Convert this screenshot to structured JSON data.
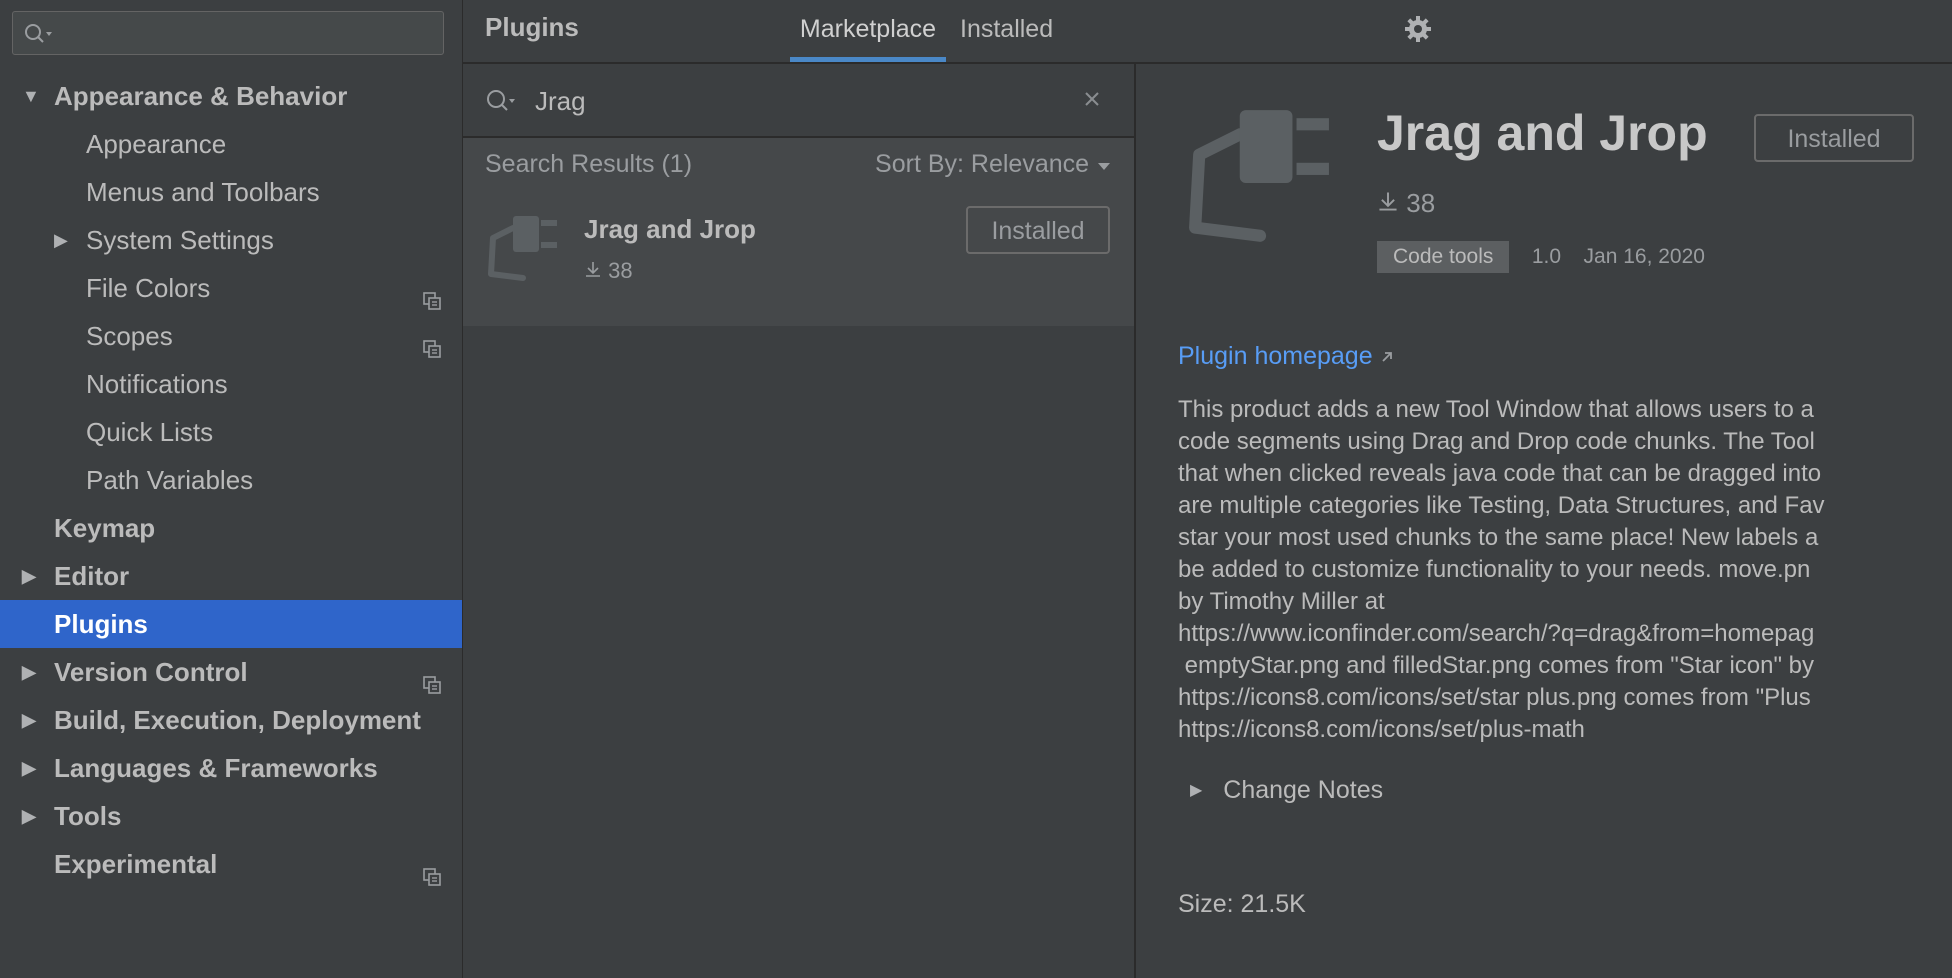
{
  "sidebar": {
    "search": {
      "placeholder": ""
    },
    "items": [
      {
        "label": "Appearance & Behavior",
        "level": 0,
        "arrow": "expanded",
        "has_copy_icon": false,
        "selected": false
      },
      {
        "label": "Appearance",
        "level": 1,
        "arrow": "none",
        "has_copy_icon": false,
        "selected": false
      },
      {
        "label": "Menus and Toolbars",
        "level": 1,
        "arrow": "none",
        "has_copy_icon": false,
        "selected": false
      },
      {
        "label": "System Settings",
        "level": 1,
        "arrow": "collapsed",
        "has_copy_icon": false,
        "selected": false
      },
      {
        "label": "File Colors",
        "level": 1,
        "arrow": "none",
        "has_copy_icon": true,
        "selected": false
      },
      {
        "label": "Scopes",
        "level": 1,
        "arrow": "none",
        "has_copy_icon": true,
        "selected": false
      },
      {
        "label": "Notifications",
        "level": 1,
        "arrow": "none",
        "has_copy_icon": false,
        "selected": false
      },
      {
        "label": "Quick Lists",
        "level": 1,
        "arrow": "none",
        "has_copy_icon": false,
        "selected": false
      },
      {
        "label": "Path Variables",
        "level": 1,
        "arrow": "none",
        "has_copy_icon": false,
        "selected": false
      },
      {
        "label": "Keymap",
        "level": 0,
        "arrow": "none",
        "has_copy_icon": false,
        "selected": false
      },
      {
        "label": "Editor",
        "level": 0,
        "arrow": "collapsed",
        "has_copy_icon": false,
        "selected": false
      },
      {
        "label": "Plugins",
        "level": 0,
        "arrow": "none",
        "has_copy_icon": false,
        "selected": true
      },
      {
        "label": "Version Control",
        "level": 0,
        "arrow": "collapsed",
        "has_copy_icon": true,
        "selected": false
      },
      {
        "label": "Build, Execution, Deployment",
        "level": 0,
        "arrow": "collapsed",
        "has_copy_icon": false,
        "selected": false
      },
      {
        "label": "Languages & Frameworks",
        "level": 0,
        "arrow": "collapsed",
        "has_copy_icon": false,
        "selected": false
      },
      {
        "label": "Tools",
        "level": 0,
        "arrow": "collapsed",
        "has_copy_icon": false,
        "selected": false
      },
      {
        "label": "Experimental",
        "level": 0,
        "arrow": "none",
        "has_copy_icon": true,
        "selected": false
      }
    ]
  },
  "header": {
    "title": "Plugins",
    "tabs": [
      {
        "label": "Marketplace",
        "active": true
      },
      {
        "label": "Installed",
        "active": false
      }
    ],
    "settings_icon": "gear-icon"
  },
  "plugin_list": {
    "search_value": "Jrag",
    "results_label": "Search Results (1)",
    "sort_label": "Sort By: Relevance",
    "results": [
      {
        "name": "Jrag and Jrop",
        "downloads": "38",
        "button": "Installed"
      }
    ]
  },
  "detail": {
    "name": "Jrag and Jrop",
    "button": "Installed",
    "downloads": "38",
    "category": "Code tools",
    "version": "1.0",
    "date": "Jan 16, 2020",
    "homepage_label": "Plugin homepage",
    "description_lines": [
      "This product adds a new Tool Window that allows users to a",
      "code segments using Drag and Drop code chunks. The Tool",
      "that when clicked reveals java code that can be dragged into",
      "are multiple categories like Testing, Data Structures, and Fav",
      "star your most used chunks to the same place! New labels a",
      "be added to customize functionality to your needs. move.pn",
      "by Timothy Miller at",
      "https://www.iconfinder.com/search/?q=drag&from=homepag",
      " emptyStar.png and filledStar.png comes from \"Star icon\" by",
      "https://icons8.com/icons/set/star plus.png comes from \"Plus",
      "https://icons8.com/icons/set/plus-math"
    ],
    "change_notes_label": "Change Notes",
    "size_label": "Size: 21.5K"
  },
  "colors": {
    "background": "#3c3f41",
    "selection": "#2f65ca",
    "link": "#589df6",
    "tab_underline": "#4a88c7"
  }
}
